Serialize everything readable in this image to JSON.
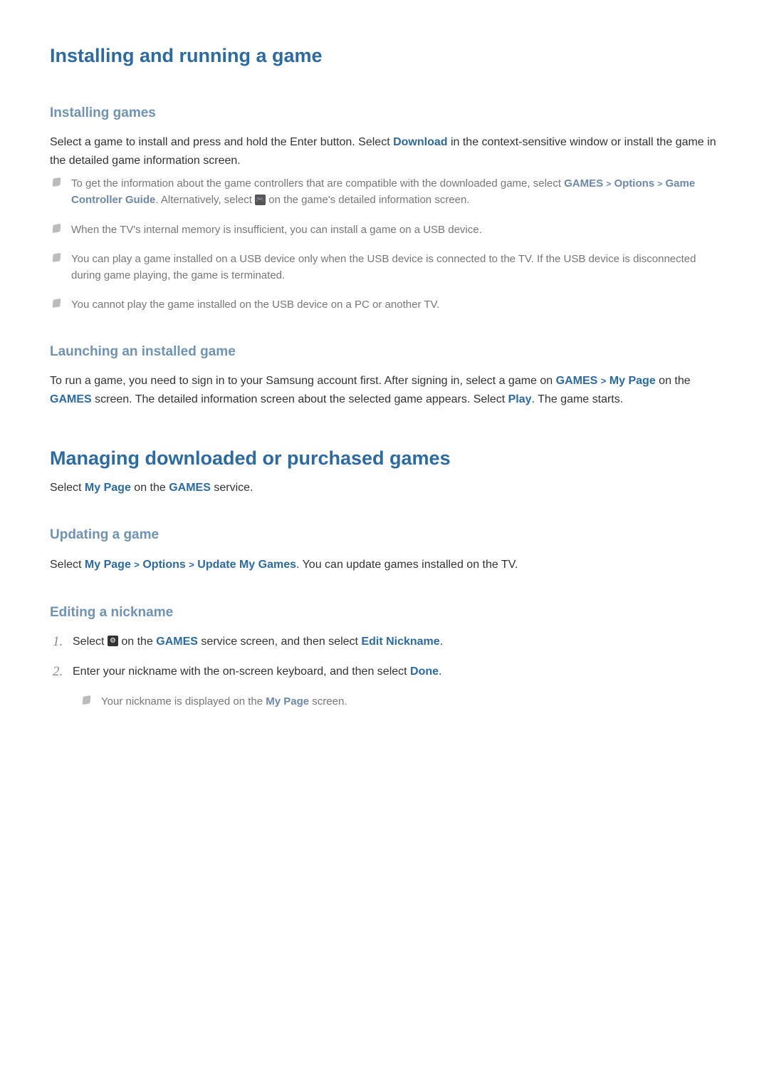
{
  "h1_1": "Installing and running a game",
  "h2_installing": "Installing games",
  "p_installing_pre": "Select a game to install and press and hold the Enter button. Select ",
  "kw_download": "Download",
  "p_installing_post": " in the context-sensitive window or install the game in the detailed game information screen.",
  "notes1": {
    "n1_a": "To get the information about the game controllers that are compatible with the downloaded game, select ",
    "kw_games": "GAMES",
    "kw_options": "Options",
    "kw_gcg": "Game Controller Guide",
    "n1_b": ". Alternatively, select ",
    "n1_c": " on the game's detailed information screen.",
    "n2": "When the TV's internal memory is insufficient, you can install a game on a USB device.",
    "n3": "You can play a game installed on a USB device only when the USB device is connected to the TV. If the USB device is disconnected during game playing, the game is terminated.",
    "n4": "You cannot play the game installed on the USB device on a PC or another TV."
  },
  "h2_launching": "Launching an installed game",
  "p_launch_a": "To run a game, you need to sign in to your Samsung account first. After signing in, select a game on ",
  "kw_games2": "GAMES",
  "kw_mypage": "My Page",
  "p_launch_b": " on the ",
  "kw_games3": "GAMES",
  "p_launch_c": " screen. The detailed information screen about the selected game appears. Select ",
  "kw_play": "Play",
  "p_launch_d": ". The game starts.",
  "h1_2": "Managing downloaded or purchased games",
  "p_managing_a": "Select ",
  "kw_mypage2": "My Page",
  "p_managing_b": " on the ",
  "kw_games4": "GAMES",
  "p_managing_c": " service.",
  "h2_updating": "Updating a game",
  "p_update_a": "Select ",
  "kw_mypage3": "My Page",
  "kw_options2": "Options",
  "kw_update": "Update My Games",
  "p_update_b": ". You can update games installed on the TV.",
  "h2_editing": "Editing a nickname",
  "step1_a": "Select ",
  "step1_b": " on the ",
  "kw_games5": "GAMES",
  "step1_c": " service screen, and then select ",
  "kw_editnick": "Edit Nickname",
  "step1_d": ".",
  "step2_a": "Enter your nickname with the on-screen keyboard, and then select ",
  "kw_done": "Done",
  "step2_b": ".",
  "subnote_a": "Your nickname is displayed on the ",
  "kw_mypage4": "My Page",
  "subnote_b": " screen."
}
